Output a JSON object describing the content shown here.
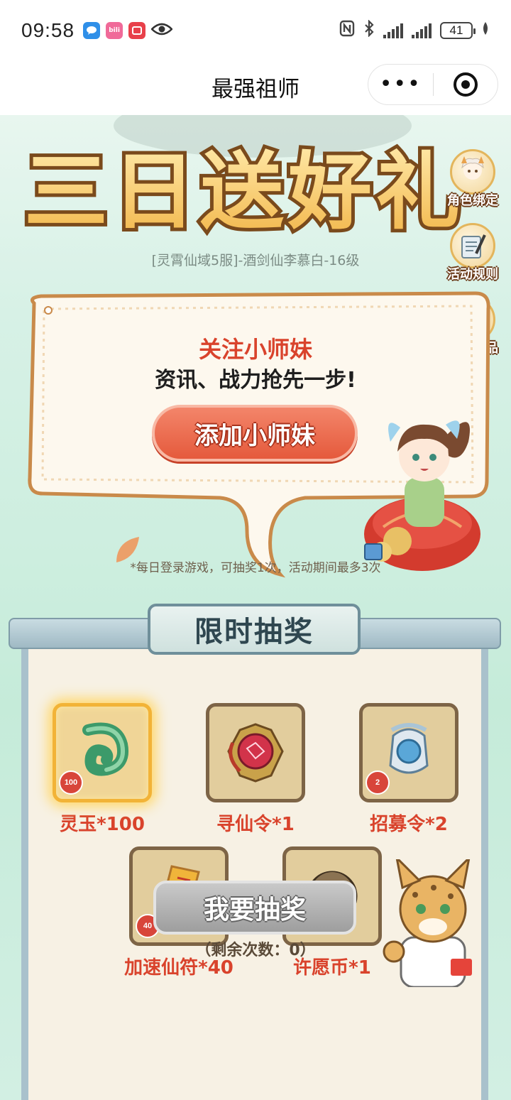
{
  "status_bar": {
    "time": "09:58",
    "battery": "41",
    "apps": [
      "message-app",
      "bilibili-app",
      "red-app"
    ]
  },
  "title_bar": {
    "title": "最强祖师",
    "more_label": "•••"
  },
  "banner": {
    "title": "三日送好礼",
    "role_info": "[灵霄仙域5服]-酒剑仙李慕白-16级"
  },
  "side_menu": [
    {
      "label": "角色绑定",
      "icon": "character-avatar-icon"
    },
    {
      "label": "活动规则",
      "icon": "scroll-brush-icon"
    },
    {
      "label": "我的奖品",
      "icon": "gift-box-icon"
    }
  ],
  "follow_card": {
    "title": "关注小师妹",
    "subtitle": "资讯、战力抢先一步!",
    "button_label": "添加小师妹"
  },
  "lottery": {
    "title": "限时抽奖",
    "note": "*每日登录游戏，可抽奖1次，活动期间最多3次",
    "prizes": [
      {
        "label": "灵玉*100",
        "badge": "100",
        "icon": "jade-icon",
        "active": true
      },
      {
        "label": "寻仙令*1",
        "badge": "",
        "icon": "red-orb-emblem-icon",
        "active": false
      },
      {
        "label": "招募令*2",
        "badge": "2",
        "icon": "recruit-token-icon",
        "active": false
      },
      {
        "label": "加速仙符*40",
        "badge": "40",
        "icon": "talisman-icon",
        "active": false
      },
      {
        "label": "许愿币*1",
        "badge": "",
        "icon": "wish-coin-icon",
        "active": false
      }
    ],
    "draw_button": "我要抽奖",
    "remaining": "（剩余次数：0）"
  },
  "colors": {
    "accent_red": "#d9432c",
    "background_mint": "#cdeedf",
    "panel_paper": "#f7f1e4"
  }
}
